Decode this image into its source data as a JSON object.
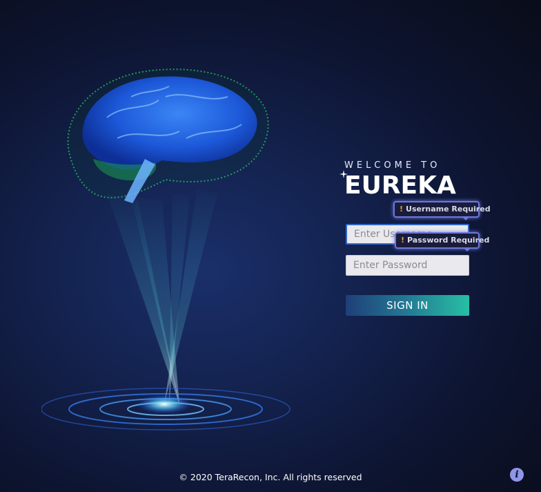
{
  "brand": {
    "welcome": "WELCOME TO",
    "logo": "EUREKA"
  },
  "login": {
    "username_placeholder": "Enter Username",
    "password_placeholder": "Enter Password",
    "signin_label": "SIGN IN"
  },
  "validation": {
    "username_error": "Username Required",
    "password_error": "Password Required",
    "error_icon": "!"
  },
  "footer": {
    "copyright": "© 2020 TeraRecon, Inc. All rights reserved"
  },
  "info": {
    "icon_glyph": "i",
    "icon": "info-icon"
  },
  "colors": {
    "accent_gradient_start": "#1f3f78",
    "accent_gradient_end": "#27bfa5",
    "tooltip_border": "#6d77d6",
    "warning": "#f0a020"
  }
}
